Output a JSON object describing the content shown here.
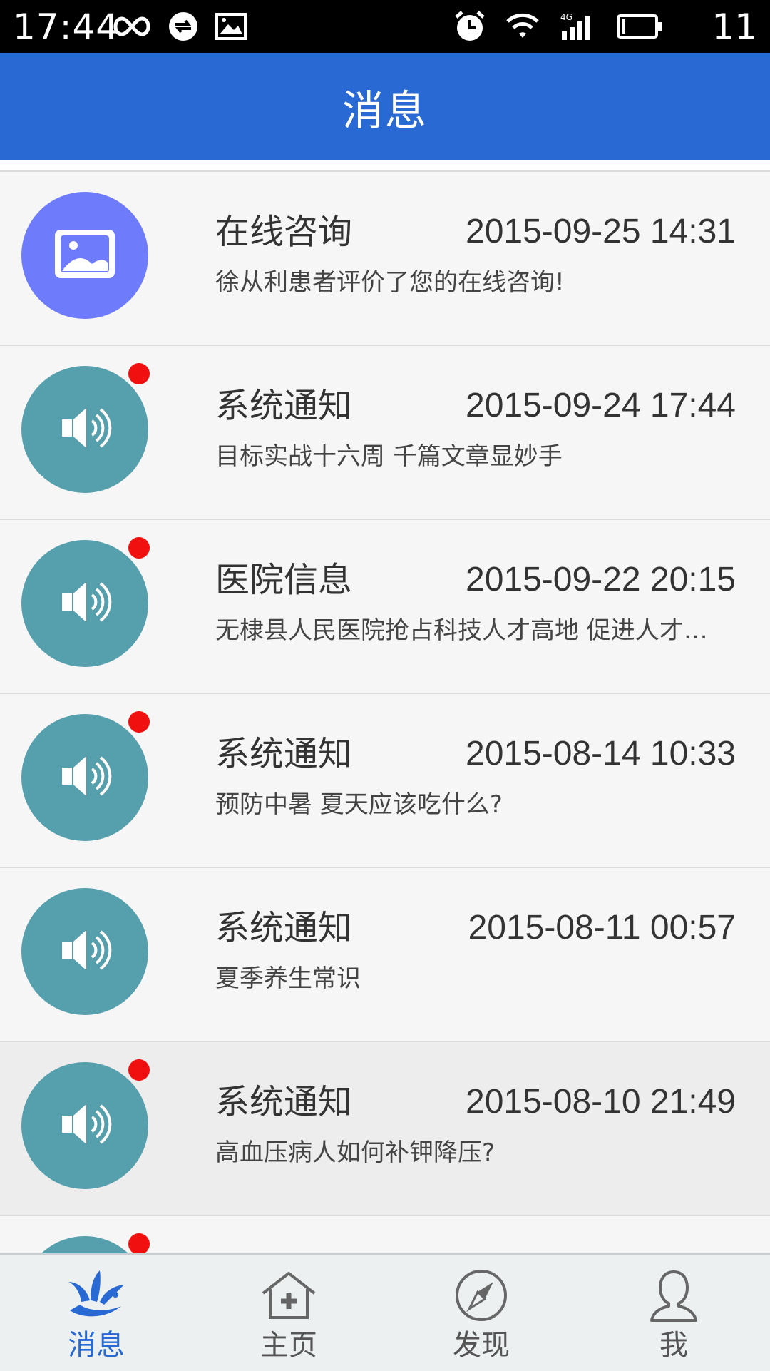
{
  "status_bar": {
    "time": "17:44",
    "battery_text": "11",
    "left_icons": [
      "infinity-icon",
      "sync-icon",
      "image-icon"
    ],
    "right_icons": [
      "alarm-icon",
      "wifi-icon",
      "signal-4g-icon",
      "battery-icon"
    ]
  },
  "header": {
    "title": "消息"
  },
  "messages": [
    {
      "title": "在线咨询",
      "time": "2015-09-25 14:31",
      "preview": "徐从利患者评价了您的在线咨询!",
      "icon": "image-icon",
      "avatar_color": "#6e7bfa",
      "unread": false
    },
    {
      "title": "系统通知",
      "time": "2015-09-24 17:44",
      "preview": "目标实战十六周 千篇文章显妙手",
      "icon": "speaker-icon",
      "avatar_color": "#569fac",
      "unread": true
    },
    {
      "title": "医院信息",
      "time": "2015-09-22 20:15",
      "preview": "无棣县人民医院抢占科技人才高地 促进人才…",
      "icon": "speaker-icon",
      "avatar_color": "#569fac",
      "unread": true
    },
    {
      "title": "系统通知",
      "time": "2015-08-14 10:33",
      "preview": "预防中暑 夏天应该吃什么?",
      "icon": "speaker-icon",
      "avatar_color": "#569fac",
      "unread": true
    },
    {
      "title": "系统通知",
      "time": "2015-08-11 00:57",
      "preview": "夏季养生常识",
      "icon": "speaker-icon",
      "avatar_color": "#569fac",
      "unread": false
    },
    {
      "title": "系统通知",
      "time": "2015-08-10 21:49",
      "preview": "高血压病人如何补钾降压?",
      "icon": "speaker-icon",
      "avatar_color": "#569fac",
      "unread": true
    },
    {
      "title": "",
      "time": "",
      "preview": "",
      "icon": "speaker-icon",
      "avatar_color": "#569fac",
      "unread": true
    }
  ],
  "nav": {
    "items": [
      {
        "label": "消息",
        "icon": "bird-icon",
        "active": true
      },
      {
        "label": "主页",
        "icon": "home-icon",
        "active": false
      },
      {
        "label": "发现",
        "icon": "compass-icon",
        "active": false
      },
      {
        "label": "我",
        "icon": "profile-icon",
        "active": false
      }
    ]
  },
  "colors": {
    "header_blue": "#2869d3",
    "active_nav": "#2869d3",
    "unread_red": "#f01010",
    "teal_avatar": "#569fac",
    "purple_avatar": "#6e7bfa"
  }
}
